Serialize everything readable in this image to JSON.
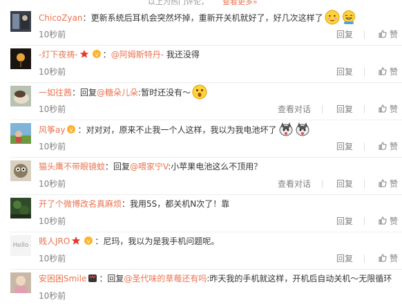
{
  "header": {
    "hot_text": "以上为热门评论，",
    "more_text": "查看更多»"
  },
  "actions": {
    "view_dialog": "查看对话",
    "reply": "回复",
    "like": "赞"
  },
  "comments": [
    {
      "nick": "ChicoZyan",
      "prefix": "：",
      "mention": "",
      "text": "更新系统后耳机会突然坏掉，重新开关机就好了，好几次这样了",
      "time": "10秒前",
      "has_dialog": false,
      "emojis": [
        "shy-face",
        "grin-face"
      ]
    },
    {
      "nick": "-灯下夜祷-",
      "prefix": "：",
      "mention": "@阿姆斯特丹-",
      "text": " 我还没得",
      "time": "10秒前",
      "has_dialog": false
    },
    {
      "nick": "一如往茜",
      "prefix": "：回复",
      "mention": "@糖朵儿朵",
      "text": ":暂时还没有～",
      "time": "10秒前",
      "has_dialog": true
    },
    {
      "nick": "风筝ay",
      "prefix": "：",
      "mention": "",
      "text": "对对对，原来不止我一个人这样，我以为我电池坏了",
      "time": "10秒前",
      "has_dialog": false
    },
    {
      "nick": "猫头鹰不带眼镜蚊",
      "prefix": "：回复",
      "mention": "@喂家宁V",
      "text": ":小苹果电池这么不顶用？",
      "time": "10秒前",
      "has_dialog": true
    },
    {
      "nick": "开了个微博改名真麻烦",
      "prefix": "：",
      "mention": "",
      "text": "我用5S，都关机N次了！靠",
      "time": "10秒前",
      "has_dialog": false
    },
    {
      "nick": "贱人JRO",
      "prefix": "：",
      "mention": "",
      "text": "尼玛，我以为是我手机问题呢。",
      "time": "10秒前",
      "has_dialog": false,
      "avatar_text": "Hello"
    },
    {
      "nick": "安困困Smile",
      "prefix": "：回复",
      "mention": "@圣代味的草莓还有吗",
      "text": ":昨天我的手机就这样，开机后自动关机～无限循环",
      "time": "10秒前",
      "has_dialog": false
    }
  ]
}
